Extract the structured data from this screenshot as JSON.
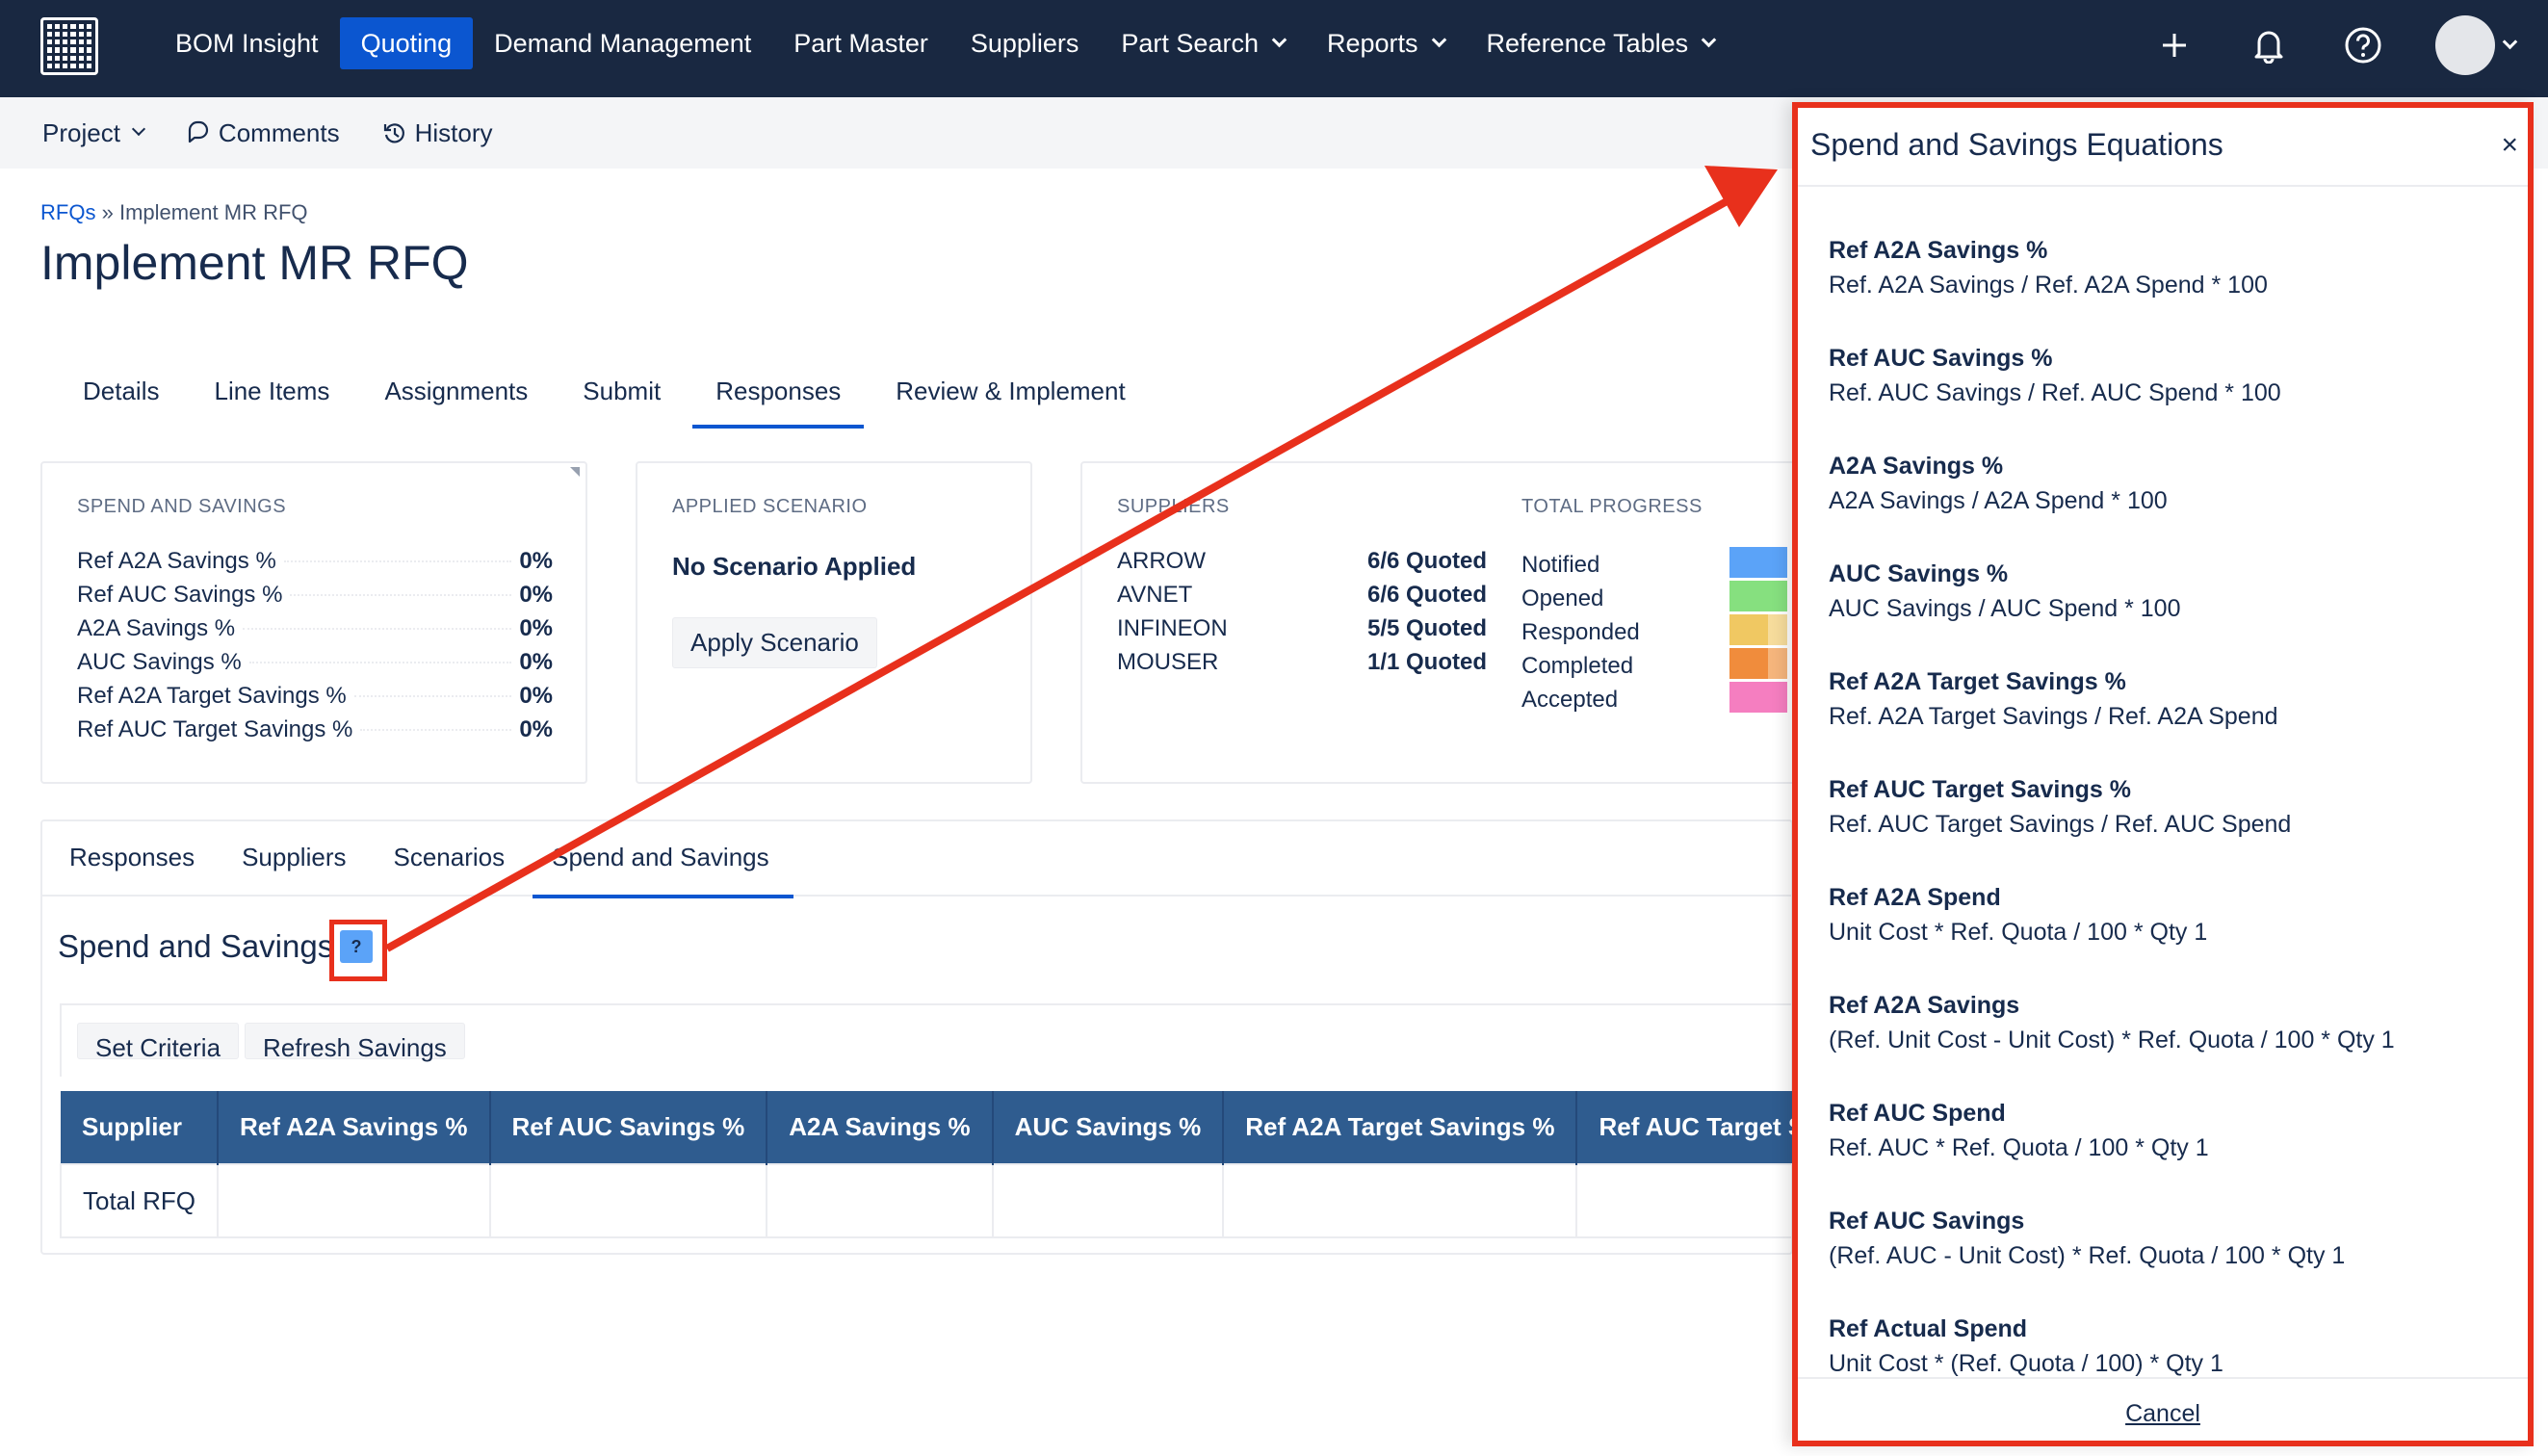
{
  "topnav": {
    "items": [
      {
        "label": "BOM Insight"
      },
      {
        "label": "Quoting",
        "active": true
      },
      {
        "label": "Demand Management"
      },
      {
        "label": "Part Master"
      },
      {
        "label": "Suppliers"
      },
      {
        "label": "Part Search",
        "dropdown": true
      },
      {
        "label": "Reports",
        "dropdown": true
      },
      {
        "label": "Reference Tables",
        "dropdown": true
      }
    ],
    "icons": [
      "plus-icon",
      "bell-icon",
      "help-circle-icon",
      "avatar",
      "chevron-down-icon"
    ]
  },
  "subnav": {
    "project": "Project",
    "comments": "Comments",
    "history": "History"
  },
  "breadcrumb": {
    "link": "RFQs",
    "separator": "»",
    "current": "Implement MR RFQ"
  },
  "page_title": "Implement MR RFQ",
  "tabs": [
    "Details",
    "Line Items",
    "Assignments",
    "Submit",
    "Responses",
    "Review & Implement"
  ],
  "active_tab": "Responses",
  "spend_card": {
    "title": "SPEND AND SAVINGS",
    "rows": [
      {
        "label": "Ref A2A Savings %",
        "value": "0%"
      },
      {
        "label": "Ref AUC Savings %",
        "value": "0%"
      },
      {
        "label": "A2A Savings %",
        "value": "0%"
      },
      {
        "label": "AUC Savings %",
        "value": "0%"
      },
      {
        "label": "Ref A2A Target Savings %",
        "value": "0%"
      },
      {
        "label": "Ref AUC Target Savings %",
        "value": "0%"
      }
    ]
  },
  "scenario_card": {
    "title": "APPLIED SCENARIO",
    "status": "No Scenario Applied",
    "button": "Apply Scenario"
  },
  "suppliers_card": {
    "title": "SUPPLIERS",
    "rows": [
      {
        "name": "ARROW",
        "value": "6/6 Quoted"
      },
      {
        "name": "AVNET",
        "value": "6/6 Quoted"
      },
      {
        "name": "INFINEON",
        "value": "5/5 Quoted"
      },
      {
        "name": "MOUSER",
        "value": "1/1 Quoted"
      }
    ]
  },
  "progress_card": {
    "title": "TOTAL PROGRESS",
    "rows": [
      {
        "label": "Notified",
        "color": "#5ba3f8"
      },
      {
        "label": "Opened",
        "color": "#86e07f"
      },
      {
        "label": "Responded",
        "color": "#f0c862"
      },
      {
        "label": "Completed",
        "color": "#f08c3c"
      },
      {
        "label": "Accepted",
        "color": "#f57ec0"
      }
    ]
  },
  "lower_tabs": [
    "Responses",
    "Suppliers",
    "Scenarios",
    "Spend and Savings"
  ],
  "lower_active_tab": "Spend and Savings",
  "section": {
    "title": "Spend and Savings",
    "help": "?"
  },
  "toolbar": {
    "set_criteria": "Set Criteria",
    "refresh": "Refresh Savings"
  },
  "table": {
    "headers": [
      "Supplier",
      "Ref A2A Savings %",
      "Ref AUC Savings %",
      "A2A Savings %",
      "AUC Savings %",
      "Ref A2A Target Savings %",
      "Ref AUC Target Savings %"
    ],
    "rows": [
      [
        "Total RFQ",
        "",
        "",
        "",
        "",
        "",
        ""
      ]
    ]
  },
  "side_panel": {
    "title": "Spend and Savings Equations",
    "close": "×",
    "equations": [
      {
        "name": "Ref A2A Savings %",
        "formula": "Ref. A2A Savings / Ref. A2A Spend * 100"
      },
      {
        "name": "Ref AUC Savings %",
        "formula": "Ref. AUC Savings / Ref. AUC Spend * 100"
      },
      {
        "name": "A2A Savings %",
        "formula": "A2A Savings / A2A Spend * 100"
      },
      {
        "name": "AUC Savings %",
        "formula": "AUC Savings / AUC Spend * 100"
      },
      {
        "name": "Ref A2A Target Savings %",
        "formula": "Ref. A2A Target Savings / Ref. A2A Spend"
      },
      {
        "name": "Ref AUC Target Savings %",
        "formula": "Ref. AUC Target Savings / Ref. AUC Spend"
      },
      {
        "name": "Ref A2A Spend",
        "formula": "Unit Cost * Ref. Quota / 100 * Qty 1"
      },
      {
        "name": "Ref A2A Savings",
        "formula": "(Ref. Unit Cost - Unit Cost) * Ref. Quota / 100 * Qty 1"
      },
      {
        "name": "Ref AUC Spend",
        "formula": "Ref. AUC * Ref. Quota / 100 * Qty 1"
      },
      {
        "name": "Ref AUC Savings",
        "formula": "(Ref. AUC - Unit Cost) * Ref. Quota / 100 * Qty 1"
      },
      {
        "name": "Ref Actual Spend",
        "formula": "Unit Cost * (Ref. Quota / 100) * Qty 1"
      }
    ],
    "cancel": "Cancel"
  },
  "annotation_color": "#e8301c"
}
